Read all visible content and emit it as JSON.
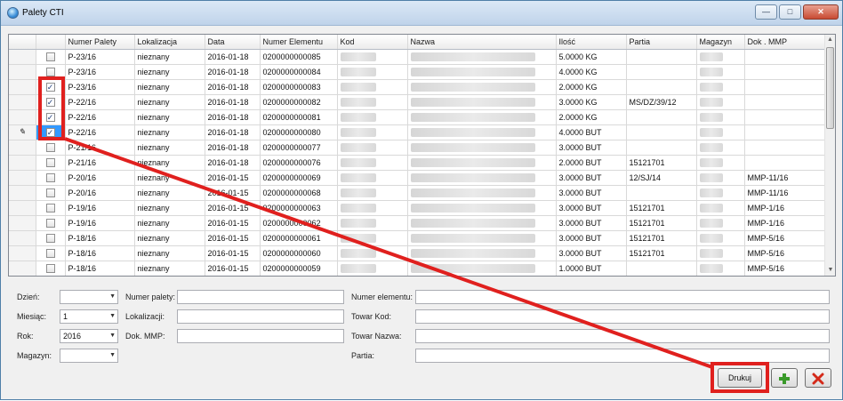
{
  "window": {
    "title": "Palety CTI",
    "minimize": "—",
    "maximize": "□",
    "close": "✕"
  },
  "grid": {
    "columns": [
      "Numer Palety",
      "Lokalizacja",
      "Data",
      "Numer Elementu",
      "Kod",
      "Nazwa",
      "Ilość",
      "Partia",
      "Magazyn",
      "Dok . MMP"
    ],
    "rows": [
      {
        "checked": false,
        "paleta": "P-23/16",
        "lok": "nieznany",
        "data": "2016-01-18",
        "element": "0200000000085",
        "ilosc": "5.0000 KG",
        "partia": "",
        "dok": ""
      },
      {
        "checked": false,
        "paleta": "P-23/16",
        "lok": "nieznany",
        "data": "2016-01-18",
        "element": "0200000000084",
        "ilosc": "4.0000 KG",
        "partia": "",
        "dok": ""
      },
      {
        "checked": true,
        "paleta": "P-23/16",
        "lok": "nieznany",
        "data": "2016-01-18",
        "element": "0200000000083",
        "ilosc": "2.0000 KG",
        "partia": "",
        "dok": ""
      },
      {
        "checked": true,
        "paleta": "P-22/16",
        "lok": "nieznany",
        "data": "2016-01-18",
        "element": "0200000000082",
        "ilosc": "3.0000 KG",
        "partia": "MS/DZ/39/12",
        "dok": ""
      },
      {
        "checked": true,
        "paleta": "P-22/16",
        "lok": "nieznany",
        "data": "2016-01-18",
        "element": "0200000000081",
        "ilosc": "2.0000 KG",
        "partia": "",
        "dok": ""
      },
      {
        "checked": true,
        "paleta": "P-22/16",
        "lok": "nieznany",
        "data": "2016-01-18",
        "element": "0200000000080",
        "ilosc": "4.0000 BUT",
        "partia": "",
        "dok": ""
      },
      {
        "checked": false,
        "paleta": "P-21/16",
        "lok": "nieznany",
        "data": "2016-01-18",
        "element": "0200000000077",
        "ilosc": "3.0000 BUT",
        "partia": "",
        "dok": ""
      },
      {
        "checked": false,
        "paleta": "P-21/16",
        "lok": "nieznany",
        "data": "2016-01-18",
        "element": "0200000000076",
        "ilosc": "2.0000 BUT",
        "partia": "15121701",
        "dok": ""
      },
      {
        "checked": false,
        "paleta": "P-20/16",
        "lok": "nieznany",
        "data": "2016-01-15",
        "element": "0200000000069",
        "ilosc": "3.0000 BUT",
        "partia": "12/SJ/14",
        "dok": "MMP-11/16"
      },
      {
        "checked": false,
        "paleta": "P-20/16",
        "lok": "nieznany",
        "data": "2016-01-15",
        "element": "0200000000068",
        "ilosc": "3.0000 BUT",
        "partia": "",
        "dok": "MMP-11/16"
      },
      {
        "checked": false,
        "paleta": "P-19/16",
        "lok": "nieznany",
        "data": "2016-01-15",
        "element": "0200000000063",
        "ilosc": "3.0000 BUT",
        "partia": "15121701",
        "dok": "MMP-1/16"
      },
      {
        "checked": false,
        "paleta": "P-19/16",
        "lok": "nieznany",
        "data": "2016-01-15",
        "element": "0200000000062",
        "ilosc": "3.0000 BUT",
        "partia": "15121701",
        "dok": "MMP-1/16"
      },
      {
        "checked": false,
        "paleta": "P-18/16",
        "lok": "nieznany",
        "data": "2016-01-15",
        "element": "0200000000061",
        "ilosc": "3.0000 BUT",
        "partia": "15121701",
        "dok": "MMP-5/16"
      },
      {
        "checked": false,
        "paleta": "P-18/16",
        "lok": "nieznany",
        "data": "2016-01-15",
        "element": "0200000000060",
        "ilosc": "3.0000 BUT",
        "partia": "15121701",
        "dok": "MMP-5/16"
      },
      {
        "checked": false,
        "paleta": "P-18/16",
        "lok": "nieznany",
        "data": "2016-01-15",
        "element": "0200000000059",
        "ilosc": "1.0000 BUT",
        "partia": "",
        "dok": "MMP-5/16"
      }
    ]
  },
  "filters": {
    "dzien_label": "Dzień:",
    "dzien_value": "",
    "miesiac_label": "Miesiąc:",
    "miesiac_value": "1",
    "rok_label": "Rok:",
    "rok_value": "2016",
    "magazyn_label": "Magazyn:",
    "magazyn_value": "",
    "numer_palety_label": "Numer palety:",
    "lokalizacja_label": "Lokalizacji:",
    "dok_mmp_label": "Dok. MMP:",
    "numer_elementu_label": "Numer elementu:",
    "towar_kod_label": "Towar Kod:",
    "towar_nazwa_label": "Towar Nazwa:",
    "partia_label": "Partia:"
  },
  "buttons": {
    "drukuj": "Drukuj",
    "add_icon": "plus-icon",
    "delete_icon": "close-icon"
  },
  "colors": {
    "highlight": "#e0201e",
    "selection": "#3399ff",
    "add": "#3a9a2a",
    "delete": "#d42a1a"
  }
}
